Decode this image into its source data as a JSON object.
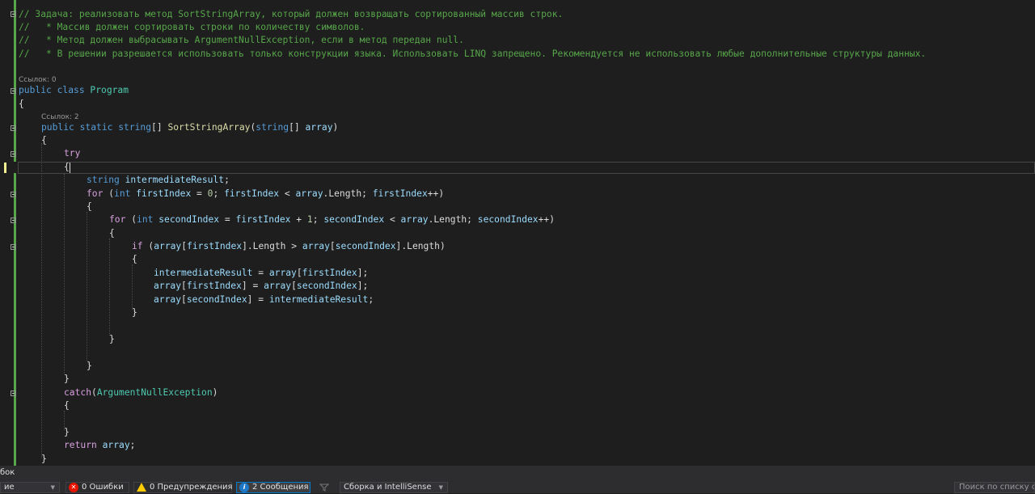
{
  "code": {
    "comments": [
      "// Задача: реализовать метод SortStringArray, который должен возвращать сортированный массив строк.",
      "//   * Массив должен сортировать строки по количеству символов.",
      "//   * Метод должен выбрасывать ArgumentNullException, если в метод передан null.",
      "//   * В решении разрешается использовать только конструкции языка. Использовать LINQ запрещено. Рекомендуется не использовать любые дополнительные структуры данных."
    ],
    "codelens": {
      "class_refs": "Ссылок: 0",
      "method_refs": "Ссылок: 2"
    },
    "lines": {
      "class_decl": "public class Program",
      "open_class": "{",
      "method_decl": "public static string[] SortStringArray(string[] array)",
      "open_method": "{",
      "try": "try",
      "open_try": "{",
      "var_decl": "string intermediateResult;",
      "for_outer": "for (int firstIndex = 0; firstIndex < array.Length; firstIndex++)",
      "open_for_outer": "{",
      "for_inner": "for (int secondIndex = firstIndex + 1; secondIndex < array.Length; secondIndex++)",
      "open_for_inner": "{",
      "if": "if (array[firstIndex].Length > array[secondIndex].Length)",
      "open_if": "{",
      "assign1": "intermediateResult = array[firstIndex];",
      "assign2": "array[firstIndex] = array[secondIndex];",
      "assign3": "array[secondIndex] = intermediateResult;",
      "close_if": "}",
      "close_for_inner": "}",
      "close_for_outer": "}",
      "close_try": "}",
      "catch": "catch(ArgumentNullException)",
      "open_catch": "{",
      "close_catch": "}",
      "return": "return array;",
      "close_method": "}"
    }
  },
  "error_list": {
    "title": "бок",
    "scope_value": "ие",
    "errors_label": "0 Ошибки",
    "warnings_label": "0 Предупреждения",
    "messages_label": "2 Сообщения",
    "build_source": "Сборка и IntelliSense",
    "search_placeholder": "Поиск по списку ош"
  },
  "colors": {
    "background": "#1e1e1e",
    "keyword": "#569cd6",
    "type": "#4ec9b0",
    "method": "#dcdcaa",
    "comment": "#57a64a",
    "parameter": "#9cdcfe",
    "control": "#d8a0df",
    "number": "#b5cea8",
    "change_bar": "#57a64a",
    "unsaved_bar": "#efef91"
  },
  "icons": {
    "errors": "error-circle-icon",
    "warnings": "warning-triangle-icon",
    "messages": "info-circle-icon",
    "filter": "filter-icon",
    "fold": "collapse-minus-icon"
  }
}
